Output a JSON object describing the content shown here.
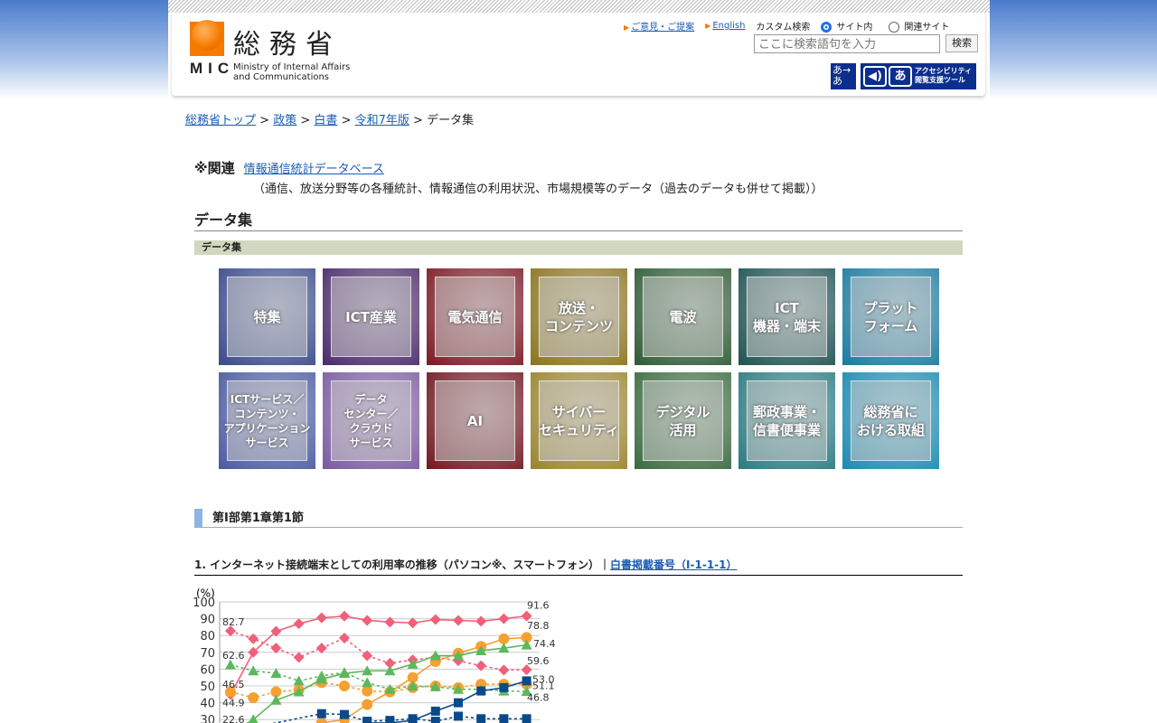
{
  "header": {
    "logo_kanji": "総務省",
    "logo_abbr": "MIC",
    "logo_english": "Ministry of Internal Affairs and Communications",
    "links": [
      "ご意見・ご提案",
      "English"
    ],
    "custom_search_label": "カスタム検索",
    "radio_options": [
      "サイト内",
      "関連サイト"
    ],
    "radio_selected": "サイト内",
    "search_placeholder": "ここに検索語句を入力",
    "search_button": "検索",
    "font_toggle": "あ→あ",
    "accessibility_label": "アクセシビリティ閲覧支援ツール"
  },
  "breadcrumb": [
    {
      "label": "総務省トップ"
    },
    {
      "label": "政策"
    },
    {
      "label": "白書"
    },
    {
      "label": "令和7年版"
    },
    {
      "label": "データ集"
    }
  ],
  "breadcrumb_sep": ">",
  "related": {
    "label": "※関連",
    "link": "情報通信統計データベース",
    "desc": "（通信、放送分野等の各種統計、情報通信の利用状況、市場規模等のデータ（過去のデータも併せて掲載））"
  },
  "section_title": "データ集",
  "section_bar": "データ集",
  "tiles": [
    {
      "label": "特集",
      "color": "#3a4a8a"
    },
    {
      "label": "ICT産業",
      "color": "#4a2a6a"
    },
    {
      "label": "電気通信",
      "color": "#7a1a24"
    },
    {
      "label": "放送・\nコンテンツ",
      "color": "#8a7420"
    },
    {
      "label": "電波",
      "color": "#2e5a34"
    },
    {
      "label": "ICT\n機器・端末",
      "color": "#1e5252"
    },
    {
      "label": "プラット\nフォーム",
      "color": "#1a7aa0"
    },
    {
      "label": "ICTサービス／\nコンテンツ・\nアプリケーション\nサービス",
      "color": "#4a5aa0"
    },
    {
      "label": "データ\nセンター／\nクラウド\nサービス",
      "color": "#7a5aa0"
    },
    {
      "label": "AI",
      "color": "#701820"
    },
    {
      "label": "サイバー\nセキュリティ",
      "color": "#9a8430"
    },
    {
      "label": "デジタル\n活用",
      "color": "#3a6a40"
    },
    {
      "label": "郵政事業・\n信書便事業",
      "color": "#2a7a80"
    },
    {
      "label": "総務省に\nおける取組",
      "color": "#1a8ab0"
    }
  ],
  "subsection": "第Ⅰ部第1章第1節",
  "figure": {
    "title": "1. インターネット接続端末としての利用率の推移（パソコン※、スマートフォン）｜",
    "link": "白書掲載番号（Ⅰ-1-1-1）"
  },
  "chart_data": {
    "type": "line",
    "ylabel": "(%)",
    "ylim": [
      0,
      100
    ],
    "yticks": [
      30,
      40,
      50,
      60,
      70,
      80,
      90,
      100
    ],
    "series": [
      {
        "name": "series-pink-solid",
        "color": "#f0607a",
        "dash": false,
        "marker": "diamond",
        "values": [
          44.9,
          70,
          82.5,
          87,
          90.5,
          91.5,
          89,
          88,
          87.5,
          89.5,
          89,
          88.5,
          90,
          91.6
        ]
      },
      {
        "name": "series-pink-dashed",
        "color": "#f0607a",
        "dash": true,
        "marker": "diamond",
        "values": [
          82.7,
          78,
          72.5,
          67,
          72.5,
          78.5,
          68,
          63.5,
          65.5,
          67,
          65,
          62,
          59.5,
          59.6
        ]
      },
      {
        "name": "series-orange-solid",
        "color": "#f5a030",
        "dash": false,
        "marker": "circle",
        "values": [
          null,
          null,
          null,
          null,
          28,
          30,
          39,
          46.5,
          55,
          64.5,
          69.5,
          73.5,
          78,
          78.8
        ]
      },
      {
        "name": "series-orange-dashed",
        "color": "#f5a030",
        "dash": true,
        "marker": "circle",
        "values": [
          46.5,
          43,
          46.5,
          47.5,
          52,
          50,
          47,
          46.5,
          49,
          50,
          49,
          51,
          51,
          51.1
        ]
      },
      {
        "name": "series-green-solid",
        "color": "#5cb85c",
        "dash": false,
        "marker": "triangle",
        "values": [
          22,
          30,
          41.5,
          46.5,
          54,
          57.5,
          59,
          59,
          63,
          68,
          68,
          71,
          72.5,
          74.4
        ]
      },
      {
        "name": "series-green-dashed",
        "color": "#5cb85c",
        "dash": true,
        "marker": "triangle",
        "values": [
          62.6,
          59,
          57.5,
          53,
          56,
          58,
          52,
          48,
          50,
          49.5,
          48,
          48,
          47,
          46.8
        ]
      },
      {
        "name": "series-navy-solid",
        "color": "#0a4a8a",
        "dash": false,
        "marker": "square",
        "values": [
          null,
          null,
          null,
          null,
          null,
          null,
          28,
          28,
          29.5,
          35,
          40,
          47,
          49,
          53.0
        ]
      },
      {
        "name": "series-navy-dashed",
        "color": "#0a4a8a",
        "dash": true,
        "marker": "square",
        "values": [
          22.6,
          null,
          null,
          null,
          33.5,
          33,
          29,
          29.5,
          30.5,
          29,
          32,
          30.5,
          30.5,
          30.5
        ]
      }
    ],
    "data_labels": [
      "91.6",
      "82.7",
      "78.8",
      "74.4",
      "62.6",
      "59.6",
      "46.5",
      "53.0",
      "51.1",
      "44.9",
      "46.8",
      "22.6"
    ]
  }
}
